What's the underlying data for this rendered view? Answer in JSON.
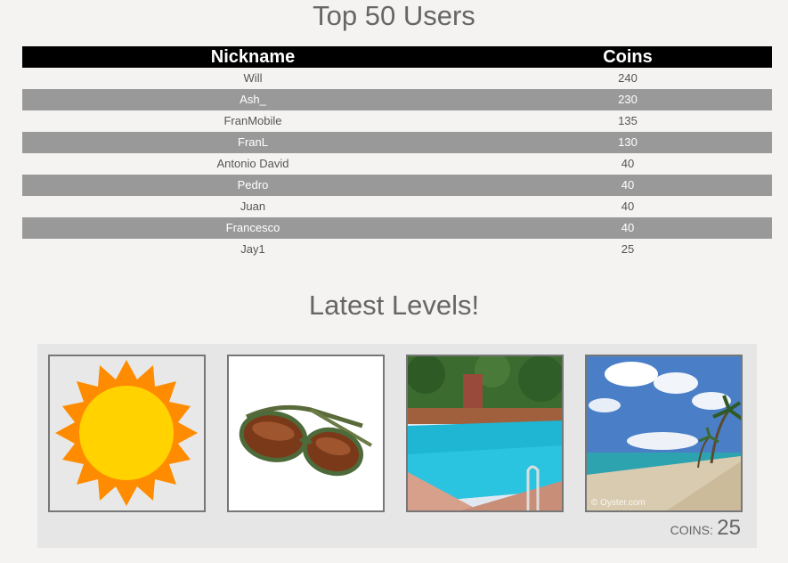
{
  "top_users": {
    "title": "Top 50 Users",
    "headers": {
      "nickname": "Nickname",
      "coins": "Coins"
    },
    "rows": [
      {
        "nickname": "Will",
        "coins": "240"
      },
      {
        "nickname": "Ash_",
        "coins": "230"
      },
      {
        "nickname": "FranMobile",
        "coins": "135"
      },
      {
        "nickname": "FranL",
        "coins": "130"
      },
      {
        "nickname": "Antonio David",
        "coins": "40"
      },
      {
        "nickname": "Pedro",
        "coins": "40"
      },
      {
        "nickname": "Juan",
        "coins": "40"
      },
      {
        "nickname": "Francesco",
        "coins": "40"
      },
      {
        "nickname": "Jay1",
        "coins": "25"
      }
    ]
  },
  "latest_levels": {
    "title": "Latest Levels!",
    "images": [
      {
        "name": "sun-image"
      },
      {
        "name": "sunglasses-image"
      },
      {
        "name": "swimming-pool-image"
      },
      {
        "name": "beach-image",
        "watermark": "© Oyster.com"
      }
    ],
    "coins_label": "COINS:",
    "coins_value": "25"
  },
  "colors": {
    "background": "#f4f3f2",
    "header_bg": "#000000",
    "alt_row_bg": "#999999",
    "panel_bg": "#e6e6e6"
  }
}
